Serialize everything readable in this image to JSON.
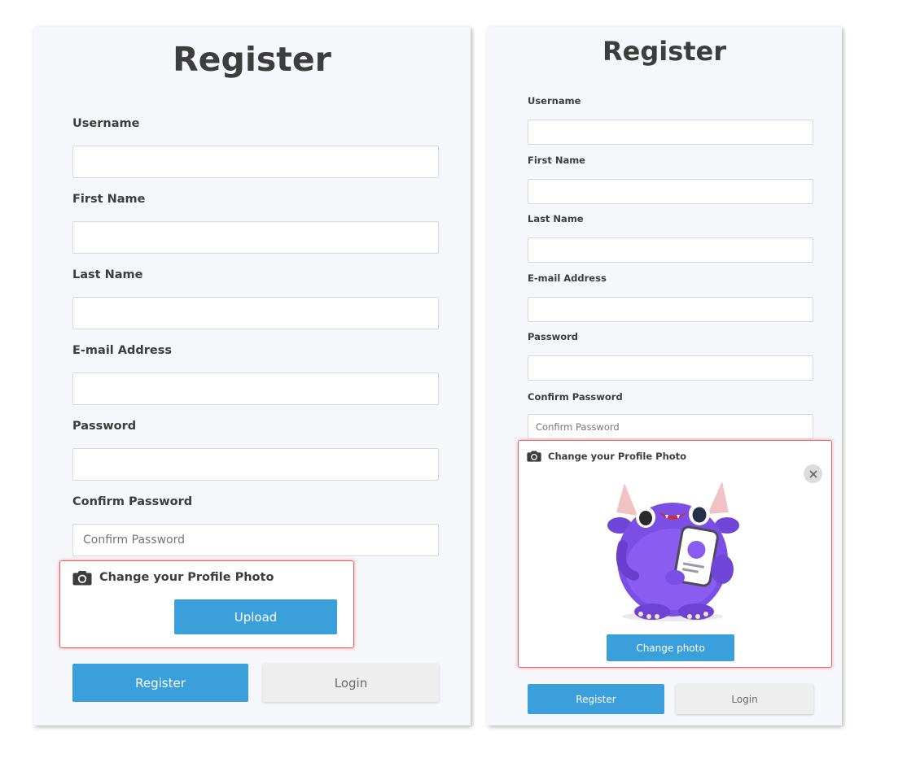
{
  "left_panel": {
    "title": "Register",
    "fields": [
      {
        "label": "Username",
        "value": "",
        "placeholder": ""
      },
      {
        "label": "First Name",
        "value": "",
        "placeholder": ""
      },
      {
        "label": "Last Name",
        "value": "",
        "placeholder": ""
      },
      {
        "label": "E-mail Address",
        "value": "",
        "placeholder": ""
      },
      {
        "label": "Password",
        "value": "",
        "placeholder": ""
      },
      {
        "label": "Confirm Password",
        "value": "",
        "placeholder": "Confirm Password"
      }
    ],
    "photo": {
      "heading": "Change your Profile Photo",
      "upload_label": "Upload",
      "icon": "camera-icon"
    },
    "register_label": "Register",
    "login_label": "Login"
  },
  "right_panel": {
    "title": "Register",
    "fields": [
      {
        "label": "Username",
        "value": "",
        "placeholder": ""
      },
      {
        "label": "First Name",
        "value": "",
        "placeholder": ""
      },
      {
        "label": "Last Name",
        "value": "",
        "placeholder": ""
      },
      {
        "label": "E-mail Address",
        "value": "",
        "placeholder": ""
      },
      {
        "label": "Password",
        "value": "",
        "placeholder": ""
      },
      {
        "label": "Confirm Password",
        "value": "",
        "placeholder": "Confirm Password"
      }
    ],
    "photo": {
      "heading": "Change your Profile Photo",
      "change_label": "Change photo",
      "icon": "camera-icon",
      "close_icon": "close-icon",
      "image": "purple-monster-avatar"
    },
    "register_label": "Register",
    "login_label": "Login"
  },
  "colors": {
    "primary_button": "#3a9fdb",
    "secondary_button": "#eeeeee",
    "panel_background": "#f5f7fa",
    "highlight_border": "#ec5e63",
    "text": "#3d3d3d"
  }
}
